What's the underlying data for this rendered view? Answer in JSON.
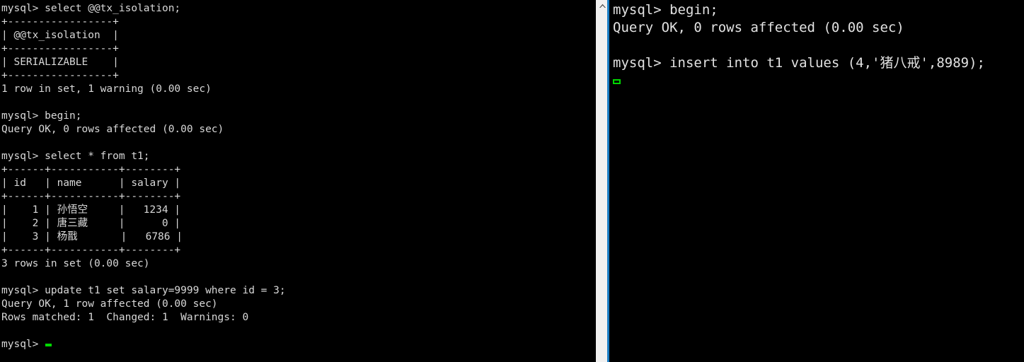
{
  "left_terminal": {
    "name": "mysql-session-a",
    "prompt": "mysql>",
    "lines": [
      "mysql> select @@tx_isolation;",
      "+-----------------+",
      "| @@tx_isolation  |",
      "+-----------------+",
      "| SERIALIZABLE    |",
      "+-----------------+",
      "1 row in set, 1 warning (0.00 sec)",
      "",
      "mysql> begin;",
      "Query OK, 0 rows affected (0.00 sec)",
      "",
      "mysql> select * from t1;",
      "+------+-----------+--------+",
      "| id   | name      | salary |",
      "+------+-----------+--------+",
      "|    1 | 孙悟空     |   1234 |",
      "|    2 | 唐三藏     |      0 |",
      "|    3 | 杨戬       |   6786 |",
      "+------+-----------+--------+",
      "3 rows in set (0.00 sec)",
      "",
      "mysql> update t1 set salary=9999 where id = 3;",
      "Query OK, 1 row affected (0.00 sec)",
      "Rows matched: 1  Changed: 1  Warnings: 0",
      "",
      "mysql> "
    ],
    "cursor_style": "solid-block",
    "cursor_color": "#00d900",
    "text_color": "#d8d8d8",
    "background_color": "#000000"
  },
  "right_terminal": {
    "name": "mysql-session-b",
    "prompt": "mysql>",
    "lines": [
      "mysql> begin;",
      "Query OK, 0 rows affected (0.00 sec)",
      "",
      "mysql> insert into t1 values (4,'猪八戒',8989);",
      ""
    ],
    "cursor_style": "hollow-block",
    "cursor_color": "#00d900",
    "text_color": "#e2e2e2",
    "background_color": "#000000",
    "active_border_color": "#1a7dc4"
  },
  "scrollbar": {
    "name": "vertical-scrollbar",
    "track_color": "#f0f0f0",
    "arrow_glyph": "caret-up",
    "position": "top"
  },
  "query_result_table": {
    "columns": [
      "id",
      "name",
      "salary"
    ],
    "rows": [
      [
        "1",
        "孙悟空",
        "1234"
      ],
      [
        "2",
        "唐三藏",
        "0"
      ],
      [
        "3",
        "杨戬",
        "6786"
      ]
    ],
    "row_count_text": "3 rows in set (0.00 sec)"
  },
  "isolation_result_table": {
    "columns": [
      "@@tx_isolation"
    ],
    "rows": [
      [
        "SERIALIZABLE"
      ]
    ],
    "row_count_text": "1 row in set, 1 warning (0.00 sec)"
  }
}
